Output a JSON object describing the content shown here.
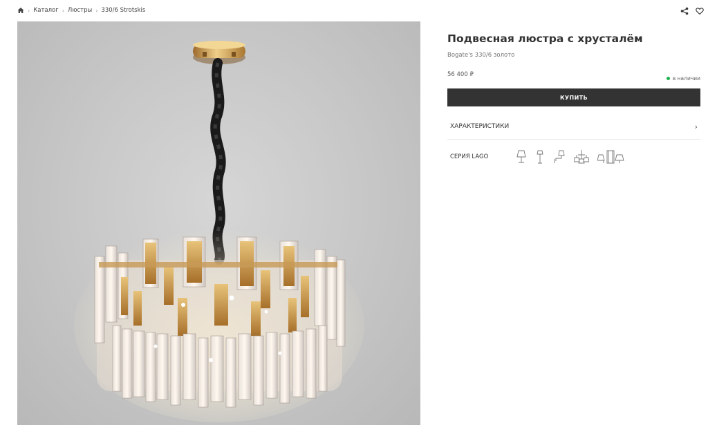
{
  "breadcrumb": {
    "home_icon": "home-icon",
    "items": [
      "Каталог",
      "Люстры",
      "330/6 Strotskis"
    ],
    "separator": "›"
  },
  "header_actions": {
    "share_icon": "share-icon",
    "favorite_icon": "heart-icon"
  },
  "product": {
    "title": "Подвесная люстра с хрусталём",
    "sku": "Bogate's 330/6 золото",
    "price": "56 400 ₽",
    "stock_status": "в наличии",
    "stock_color": "#1db34f",
    "buy_label": "КУПИТЬ",
    "image": "chandelier-photo"
  },
  "sections": {
    "specs_label": "ХАРАКТЕРИСТИКИ",
    "specs_icon": "chevron-right-icon",
    "series_label": "СЕРИЯ LAGO"
  },
  "series_items": [
    "table-lamp-icon",
    "floor-lamp-icon",
    "wall-sconce-icon",
    "chandelier-icon",
    "lamp-set-icon"
  ],
  "colors": {
    "button_bg": "#333333",
    "text": "#333333"
  }
}
